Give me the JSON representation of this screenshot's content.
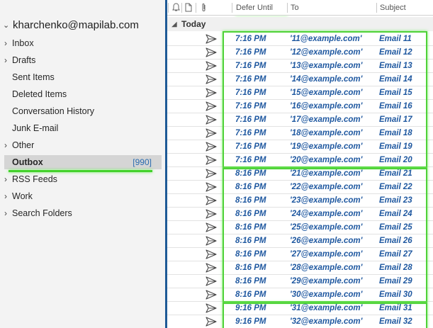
{
  "account": {
    "name": "kharchenko@mapilab.com"
  },
  "folders": [
    {
      "name": "Inbox",
      "expandable": true,
      "count": ""
    },
    {
      "name": "Drafts",
      "expandable": true,
      "count": ""
    },
    {
      "name": "Sent Items",
      "expandable": false,
      "count": ""
    },
    {
      "name": "Deleted Items",
      "expandable": false,
      "count": ""
    },
    {
      "name": "Conversation History",
      "expandable": false,
      "count": ""
    },
    {
      "name": "Junk E-mail",
      "expandable": false,
      "count": ""
    },
    {
      "name": "Other",
      "expandable": true,
      "count": ""
    },
    {
      "name": "Outbox",
      "expandable": false,
      "count": "[990]",
      "selected": true
    },
    {
      "name": "RSS Feeds",
      "expandable": true,
      "count": ""
    },
    {
      "name": "Work",
      "expandable": true,
      "count": ""
    },
    {
      "name": "Search Folders",
      "expandable": true,
      "count": ""
    }
  ],
  "columns": {
    "defer": "Defer Until",
    "to": "To",
    "subject": "Subject"
  },
  "group": {
    "label": "Today"
  },
  "icons": {
    "reminder": "bell-icon",
    "type": "document-icon",
    "attachment": "paperclip-icon",
    "send": "send-icon"
  },
  "messages": [
    {
      "time": "7:16 PM",
      "to": "'11@example.com'",
      "subject": "Email 11"
    },
    {
      "time": "7:16 PM",
      "to": "'12@example.com'",
      "subject": "Email 12"
    },
    {
      "time": "7:16 PM",
      "to": "'13@example.com'",
      "subject": "Email 13"
    },
    {
      "time": "7:16 PM",
      "to": "'14@example.com'",
      "subject": "Email 14"
    },
    {
      "time": "7:16 PM",
      "to": "'15@example.com'",
      "subject": "Email 15"
    },
    {
      "time": "7:16 PM",
      "to": "'16@example.com'",
      "subject": "Email 16"
    },
    {
      "time": "7:16 PM",
      "to": "'17@example.com'",
      "subject": "Email 17"
    },
    {
      "time": "7:16 PM",
      "to": "'18@example.com'",
      "subject": "Email 18"
    },
    {
      "time": "7:16 PM",
      "to": "'19@example.com'",
      "subject": "Email 19"
    },
    {
      "time": "7:16 PM",
      "to": "'20@example.com'",
      "subject": "Email 20"
    },
    {
      "time": "8:16 PM",
      "to": "'21@example.com'",
      "subject": "Email 21"
    },
    {
      "time": "8:16 PM",
      "to": "'22@example.com'",
      "subject": "Email 22"
    },
    {
      "time": "8:16 PM",
      "to": "'23@example.com'",
      "subject": "Email 23"
    },
    {
      "time": "8:16 PM",
      "to": "'24@example.com'",
      "subject": "Email 24"
    },
    {
      "time": "8:16 PM",
      "to": "'25@example.com'",
      "subject": "Email 25"
    },
    {
      "time": "8:16 PM",
      "to": "'26@example.com'",
      "subject": "Email 26"
    },
    {
      "time": "8:16 PM",
      "to": "'27@example.com'",
      "subject": "Email 27"
    },
    {
      "time": "8:16 PM",
      "to": "'28@example.com'",
      "subject": "Email 28"
    },
    {
      "time": "8:16 PM",
      "to": "'29@example.com'",
      "subject": "Email 29"
    },
    {
      "time": "8:16 PM",
      "to": "'30@example.com'",
      "subject": "Email 30"
    },
    {
      "time": "9:16 PM",
      "to": "'31@example.com'",
      "subject": "Email 31"
    },
    {
      "time": "9:16 PM",
      "to": "'32@example.com'",
      "subject": "Email 32"
    }
  ],
  "colors": {
    "accent": "#1f58a0",
    "highlight": "#43d12b",
    "selected": "#d5d5d5",
    "count": "#2b6cb0"
  }
}
